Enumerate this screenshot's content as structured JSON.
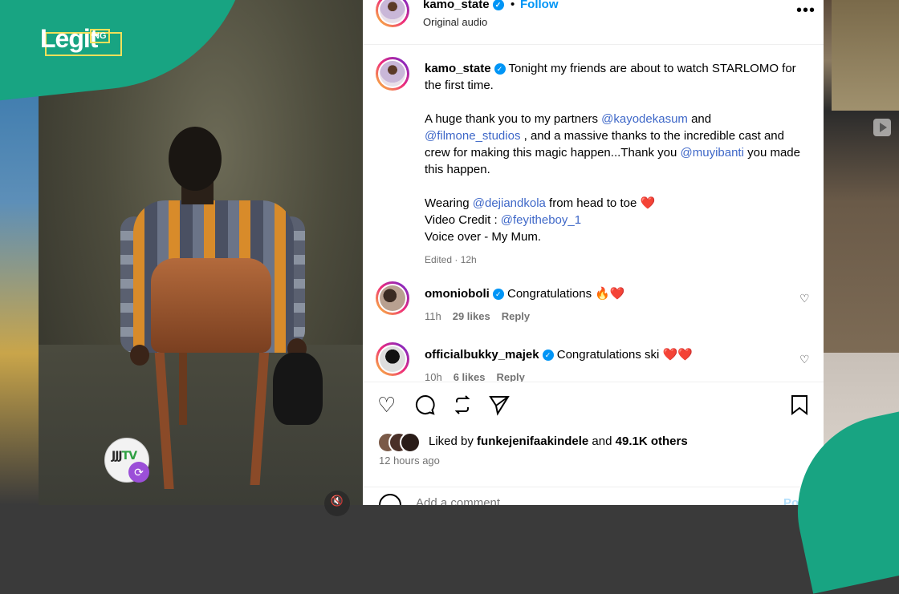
{
  "logo": {
    "text": "Legit",
    "suffix": "NG"
  },
  "watermark": {
    "text": "JJJ",
    "highlight": "TV"
  },
  "post": {
    "author": "kamo_state",
    "follow_label": "Follow",
    "dot": "•",
    "audio": "Original audio",
    "more": "•••",
    "caption": {
      "author": "kamo_state",
      "line1": "Tonight my friends are about to watch STARLOMO for the first time.",
      "p2_a": "A huge thank you to my partners ",
      "mention_kayode": "@kayodekasum",
      "p2_b": " and ",
      "mention_filmone": "@filmone_studios",
      "p2_c": " , and a massive thanks to the incredible cast and crew for making this magic happen...Thank you ",
      "mention_muyi": "@muyibanti",
      "p2_d": " you made this happen.",
      "p3_a": "Wearing ",
      "mention_dejiand": "@dejiandkola",
      "p3_b": " from head to toe ",
      "p3_heart": "❤️",
      "p4_a": "Video Credit : ",
      "mention_feyi": "@feyitheboy_1",
      "p5": "Voice over - My Mum.",
      "meta": "Edited · 12h"
    }
  },
  "comments": [
    {
      "user": "omonioboli",
      "text": "Congratulations",
      "emoji": "🔥❤️",
      "time": "11h",
      "likes": "29 likes",
      "reply": "Reply"
    },
    {
      "user": "officialbukky_majek",
      "text": "Congratulations ski",
      "emoji": "❤️❤️",
      "time": "10h",
      "likes": "6 likes",
      "reply": "Reply"
    }
  ],
  "footer": {
    "liked_prefix": "Liked by ",
    "liked_user": "funkejenifaakindele",
    "liked_mid": " and ",
    "liked_count": "49.1K others",
    "ago": "12 hours ago",
    "add_comment": "Add a comment...",
    "post": "Post"
  },
  "icons": [
    "heart-icon",
    "comment-icon",
    "repost-icon",
    "share-icon",
    "bookmark-icon",
    "mute-icon",
    "play-icon",
    "verified-icon",
    "emoji-icon"
  ]
}
